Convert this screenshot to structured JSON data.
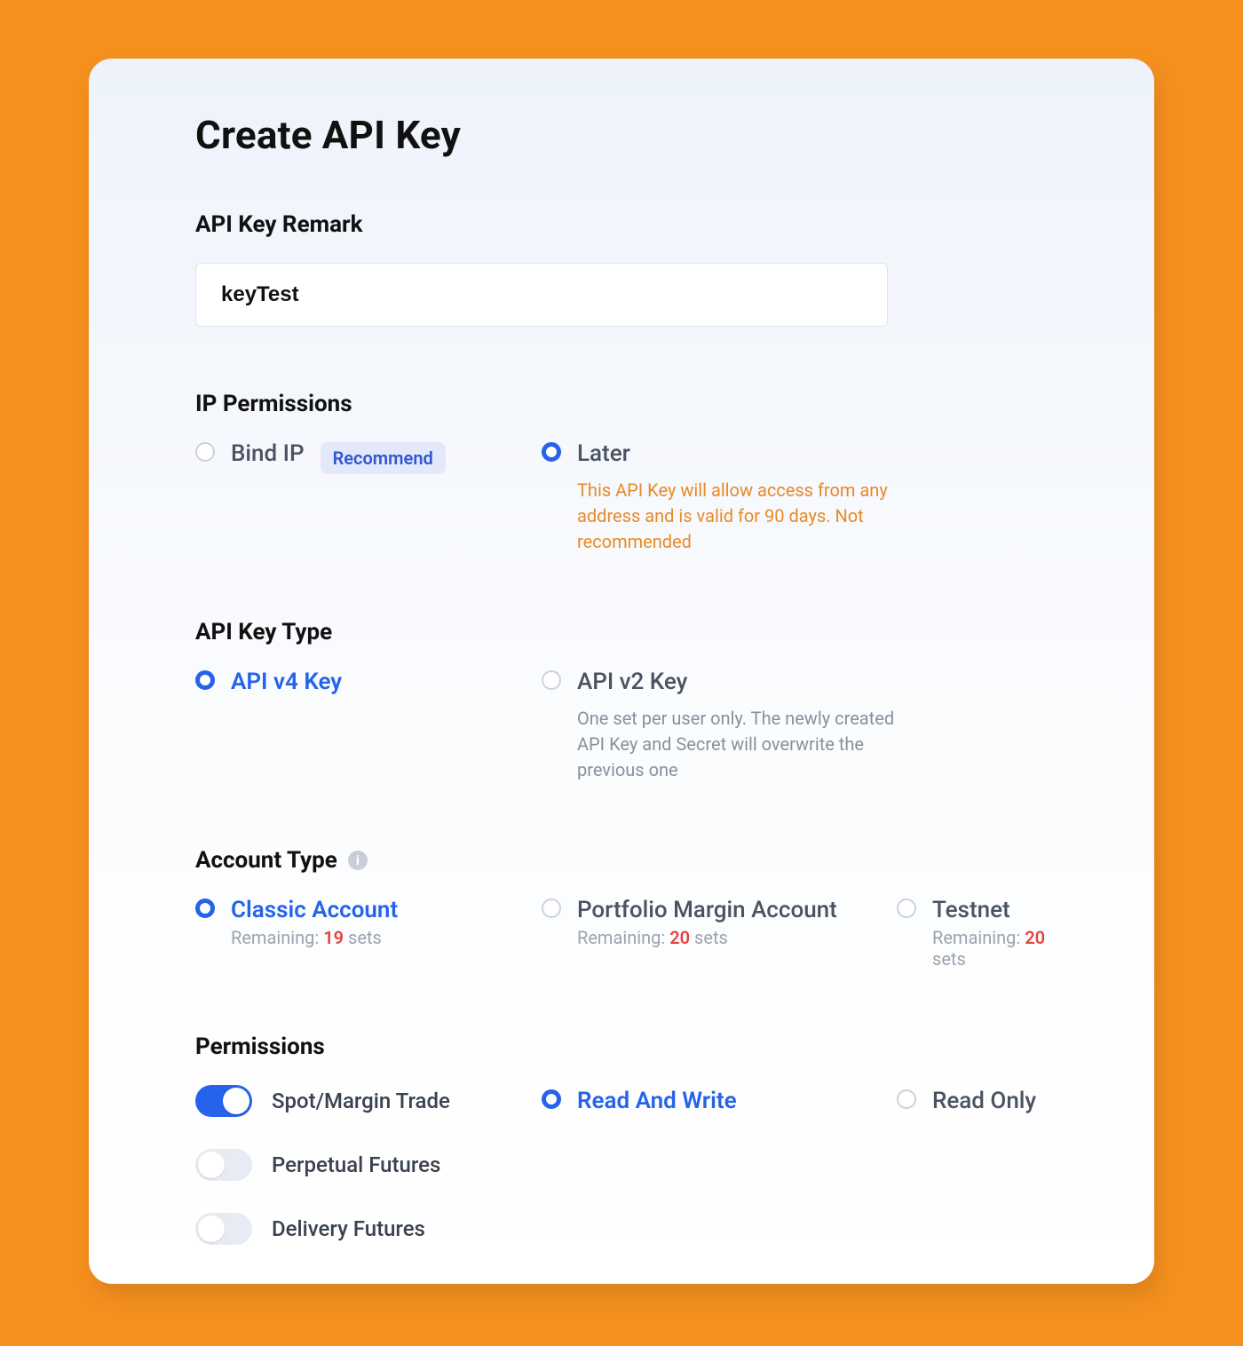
{
  "title": "Create API Key",
  "remark": {
    "label": "API Key Remark",
    "value": "keyTest"
  },
  "ip_permissions": {
    "label": "IP Permissions",
    "options": [
      {
        "id": "bind-ip",
        "label": "Bind IP",
        "selected": false,
        "badge": "Recommend"
      },
      {
        "id": "later",
        "label": "Later",
        "selected": true,
        "hint": "This API Key will allow access from any address and is valid for 90 days. Not recommended",
        "hint_style": "orange"
      }
    ]
  },
  "key_type": {
    "label": "API Key Type",
    "options": [
      {
        "id": "v4",
        "label": "API v4 Key",
        "selected": true
      },
      {
        "id": "v2",
        "label": "API v2 Key",
        "selected": false,
        "hint": "One set per user only. The newly created API Key and Secret will overwrite the previous one"
      }
    ]
  },
  "account_type": {
    "label": "Account Type",
    "options": [
      {
        "id": "classic",
        "label": "Classic Account",
        "selected": true,
        "remaining_prefix": "Remaining: ",
        "remaining_count": "19",
        "remaining_suffix": " sets"
      },
      {
        "id": "portfolio",
        "label": "Portfolio Margin Account",
        "selected": false,
        "remaining_prefix": "Remaining: ",
        "remaining_count": "20",
        "remaining_suffix": " sets"
      },
      {
        "id": "testnet",
        "label": "Testnet",
        "selected": false,
        "remaining_prefix": "Remaining: ",
        "remaining_count": "20",
        "remaining_suffix": " sets"
      }
    ]
  },
  "permissions": {
    "label": "Permissions",
    "rows": [
      {
        "id": "spot",
        "label": "Spot/Margin Trade",
        "enabled": true,
        "modes": [
          {
            "id": "rw",
            "label": "Read And Write",
            "selected": true
          },
          {
            "id": "ro",
            "label": "Read Only",
            "selected": false
          }
        ]
      },
      {
        "id": "perpetual",
        "label": "Perpetual Futures",
        "enabled": false,
        "modes": []
      },
      {
        "id": "delivery",
        "label": "Delivery Futures",
        "enabled": false,
        "modes": []
      }
    ]
  }
}
